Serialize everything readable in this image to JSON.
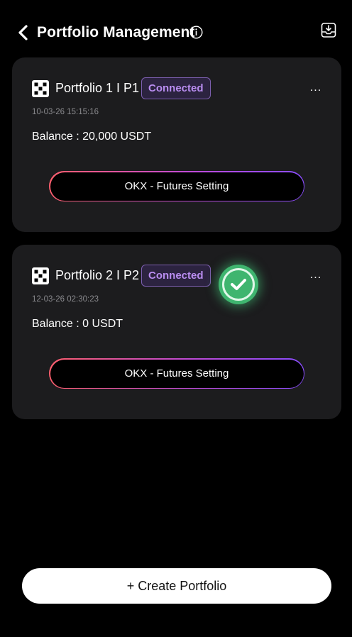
{
  "header": {
    "title": "Portfolio Management"
  },
  "portfolios": [
    {
      "name": "Portfolio 1 I P1",
      "status": "Connected",
      "timestamp": "10-03-26 15:15:16",
      "balance": "Balance : 20,000 USDT",
      "setting_label": "OKX - Futures Setting",
      "more": "..."
    },
    {
      "name": "Portfolio 2 I P2",
      "status": "Connected",
      "timestamp": "12-03-26 02:30:23",
      "balance": "Balance : 0 USDT",
      "setting_label": "OKX - Futures Setting",
      "more": "..."
    }
  ],
  "create_button": "+ Create Portfolio",
  "colors": {
    "background": "#000000",
    "card": "#1c1c1e",
    "badge_text": "#b98df0",
    "success": "#3fb56f"
  },
  "icons": [
    "chevron-left-icon",
    "info-icon",
    "export-icon",
    "okx-logo",
    "check-circle-icon",
    "more-icon"
  ]
}
